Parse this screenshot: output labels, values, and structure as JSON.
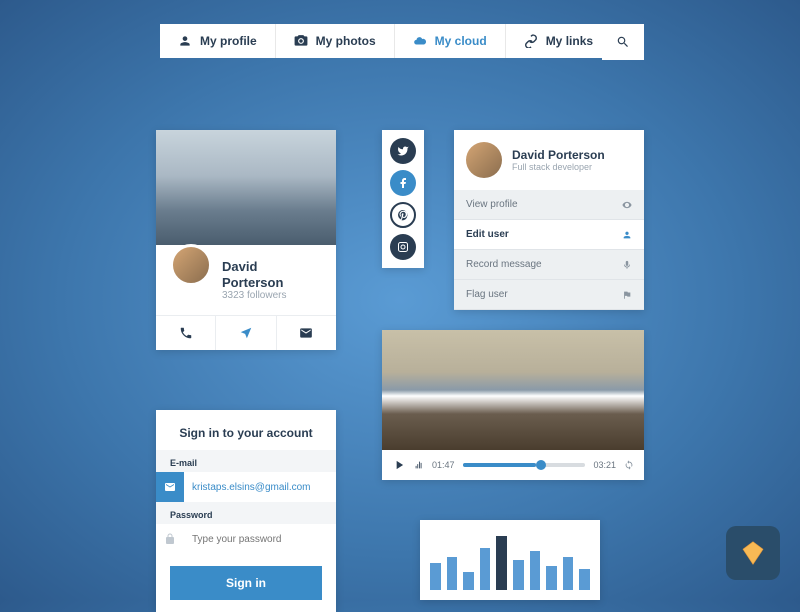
{
  "tabs": [
    {
      "label": "My profile"
    },
    {
      "label": "My photos"
    },
    {
      "label": "My cloud",
      "active": true
    },
    {
      "label": "My links"
    }
  ],
  "profile": {
    "name": "David Porterson",
    "followers": "3323 followers"
  },
  "user_card": {
    "name": "David Porterson",
    "role": "Full stack developer",
    "items": [
      {
        "label": "View profile"
      },
      {
        "label": "Edit user",
        "selected": true
      },
      {
        "label": "Record message"
      },
      {
        "label": "Flag user"
      }
    ]
  },
  "video": {
    "current": "01:47",
    "total": "03:21"
  },
  "signin": {
    "title": "Sign in to your account",
    "email_label": "E-mail",
    "email_value": "kristaps.elsins@gmail.com",
    "password_label": "Password",
    "password_placeholder": "Type your password",
    "button": "Sign in"
  },
  "chart_data": {
    "type": "bar",
    "values": [
      45,
      55,
      30,
      70,
      90,
      50,
      65,
      40,
      55,
      35
    ],
    "highlight_index": 4
  }
}
